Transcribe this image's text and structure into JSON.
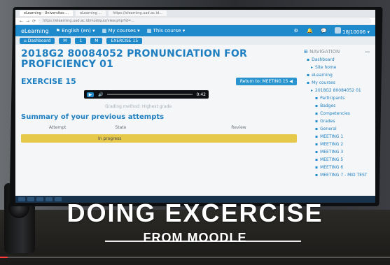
{
  "browser": {
    "tabs": [
      "eLearning - Universitas ...",
      "eLearning ...",
      "https://elearning.uad.ac.id..."
    ],
    "url": "https://elearning.uad.ac.id/mod/quiz/view.php?id=..."
  },
  "navbar": {
    "brand": "eLearning",
    "language": "English (en) ▾",
    "my_courses": "My courses ▾",
    "this_course": "This course ▾",
    "user": "18J10006 ▾"
  },
  "breadcrumb": [
    "Dashboard",
    "M",
    "1",
    "M",
    "EXERCISE 15"
  ],
  "course": {
    "title": "2018G2 80084052 PRONUNCIATION FOR PROFICIENCY 01"
  },
  "exercise": {
    "title": "EXERCISE 15",
    "return_button": "Return to: MEETING 15 ◀",
    "player_time": "0:42",
    "player_progress": 0.08,
    "grading_method": "Grading method: Highest grade",
    "summary_title": "Summary of your previous attempts",
    "table_headers": [
      "Attempt",
      "State",
      "Review"
    ],
    "row_state": "In progress"
  },
  "navigation": {
    "title": "NAVIGATION",
    "items": [
      {
        "label": "Dashboard",
        "level": 1
      },
      {
        "label": "Site home",
        "level": 2
      },
      {
        "label": "eLearning",
        "level": 1
      },
      {
        "label": "My courses",
        "level": 1
      },
      {
        "label": "2018G2 80084052 01",
        "level": 2
      },
      {
        "label": "Participants",
        "level": 3
      },
      {
        "label": "Badges",
        "level": 3
      },
      {
        "label": "Competencies",
        "level": 3
      },
      {
        "label": "Grades",
        "level": 3
      },
      {
        "label": "General",
        "level": 3
      },
      {
        "label": "MEETING 1",
        "level": 3
      },
      {
        "label": "MEETING 2",
        "level": 3
      },
      {
        "label": "MEETING 3",
        "level": 3
      },
      {
        "label": "MEETING 5",
        "level": 3
      },
      {
        "label": "MEETING 6",
        "level": 3
      },
      {
        "label": "MEETING 7 - MID TEST",
        "level": 3
      }
    ]
  },
  "overlay": {
    "line1": "DOING EXCERCISE",
    "line2": "FROM MOODLE"
  },
  "video": {
    "progress": 0.02
  }
}
